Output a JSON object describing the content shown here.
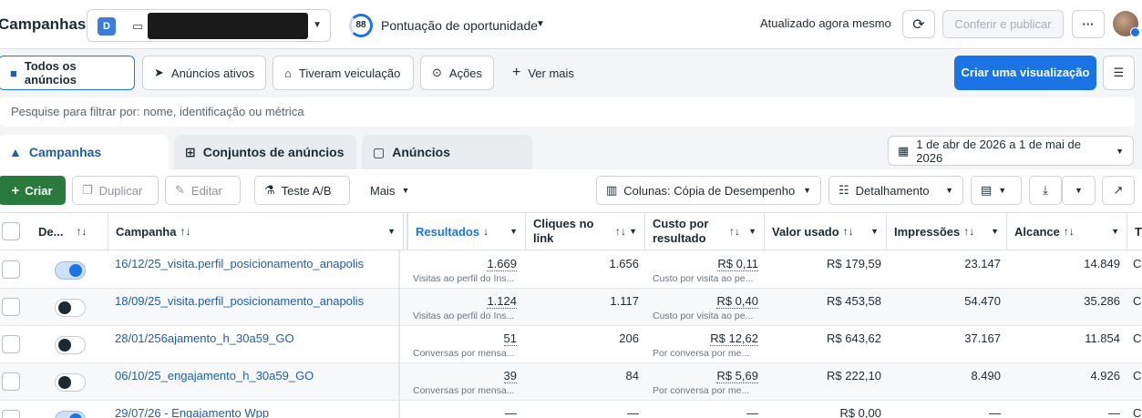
{
  "header": {
    "title": "Campanhas",
    "account_badge": "D",
    "opportunity_score": "88",
    "opportunity_label": "Pontuação de oportunidade",
    "updated": "Atualizado agora mesmo",
    "publish_label": "Conferir e publicar",
    "more": "···"
  },
  "filters": {
    "all_ads": "Todos os anúncios",
    "active_ads": "Anúncios ativos",
    "delivered": "Tiveram veiculação",
    "actions": "Ações",
    "see_more": "Ver mais",
    "create_view": "Criar uma visualização"
  },
  "search": {
    "placeholder": "Pesquise para filtrar por: nome, identificação ou métrica"
  },
  "tabs": {
    "campaigns": "Campanhas",
    "adsets": "Conjuntos de anúncios",
    "ads": "Anúncios"
  },
  "date_range": "1 de abr de 2026 a 1 de mai de 2026",
  "toolbar": {
    "create": "Criar",
    "duplicate": "Duplicar",
    "edit": "Editar",
    "ab_test": "Teste A/B",
    "more": "Mais",
    "columns": "Colunas: Cópia de Desempenho",
    "breakdown": "Detalhamento"
  },
  "columns": {
    "delivery": "De...",
    "campaign": "Campanha",
    "results": "Resultados",
    "link_clicks": "Cliques no link",
    "cost_per_result": "Custo por resultado",
    "amount_spent": "Valor usado",
    "impressions": "Impressões",
    "reach": "Alcance",
    "next": "T"
  },
  "rows": [
    {
      "name": "16/12/25_visita.perfil_posicionamento_anapolis",
      "results": "1.669",
      "results_sub": "Visitas ao perfil do Ins...",
      "clicks": "1.656",
      "cpr": "R$ 0,11",
      "cpr_sub": "Custo por visita ao pe...",
      "spent": "R$ 179,59",
      "impressions": "23.147",
      "reach": "14.849",
      "on": true
    },
    {
      "name": "18/09/25_visita.perfil_posicionamento_anapolis",
      "results": "1.124",
      "results_sub": "Visitas ao perfil do Ins...",
      "clicks": "1.117",
      "cpr": "R$ 0,40",
      "cpr_sub": "Custo por visita ao pe...",
      "spent": "R$ 453,58",
      "impressions": "54.470",
      "reach": "35.286",
      "on": false
    },
    {
      "name": "28/01/256ajamento_h_30a59_GO",
      "results": "51",
      "results_sub": "Conversas por mensa...",
      "clicks": "206",
      "cpr": "R$ 12,62",
      "cpr_sub": "Por conversa por me...",
      "spent": "R$ 643,62",
      "impressions": "37.167",
      "reach": "11.854",
      "on": false
    },
    {
      "name": "06/10/25_engajamento_h_30a59_GO",
      "results": "39",
      "results_sub": "Conversas por mensa...",
      "clicks": "84",
      "cpr": "R$ 5,69",
      "cpr_sub": "Por conversa por me...",
      "spent": "R$ 222,10",
      "impressions": "8.490",
      "reach": "4.926",
      "on": false
    },
    {
      "name": "29/07/26 - Engajamento Wpp",
      "results": "—",
      "results_sub": "",
      "clicks": "—",
      "cpr": "—",
      "cpr_sub": "",
      "spent": "R$ 0,00",
      "impressions": "—",
      "reach": "—",
      "on": true
    }
  ],
  "trailing": [
    "C",
    "C",
    "C",
    "C",
    "C"
  ]
}
